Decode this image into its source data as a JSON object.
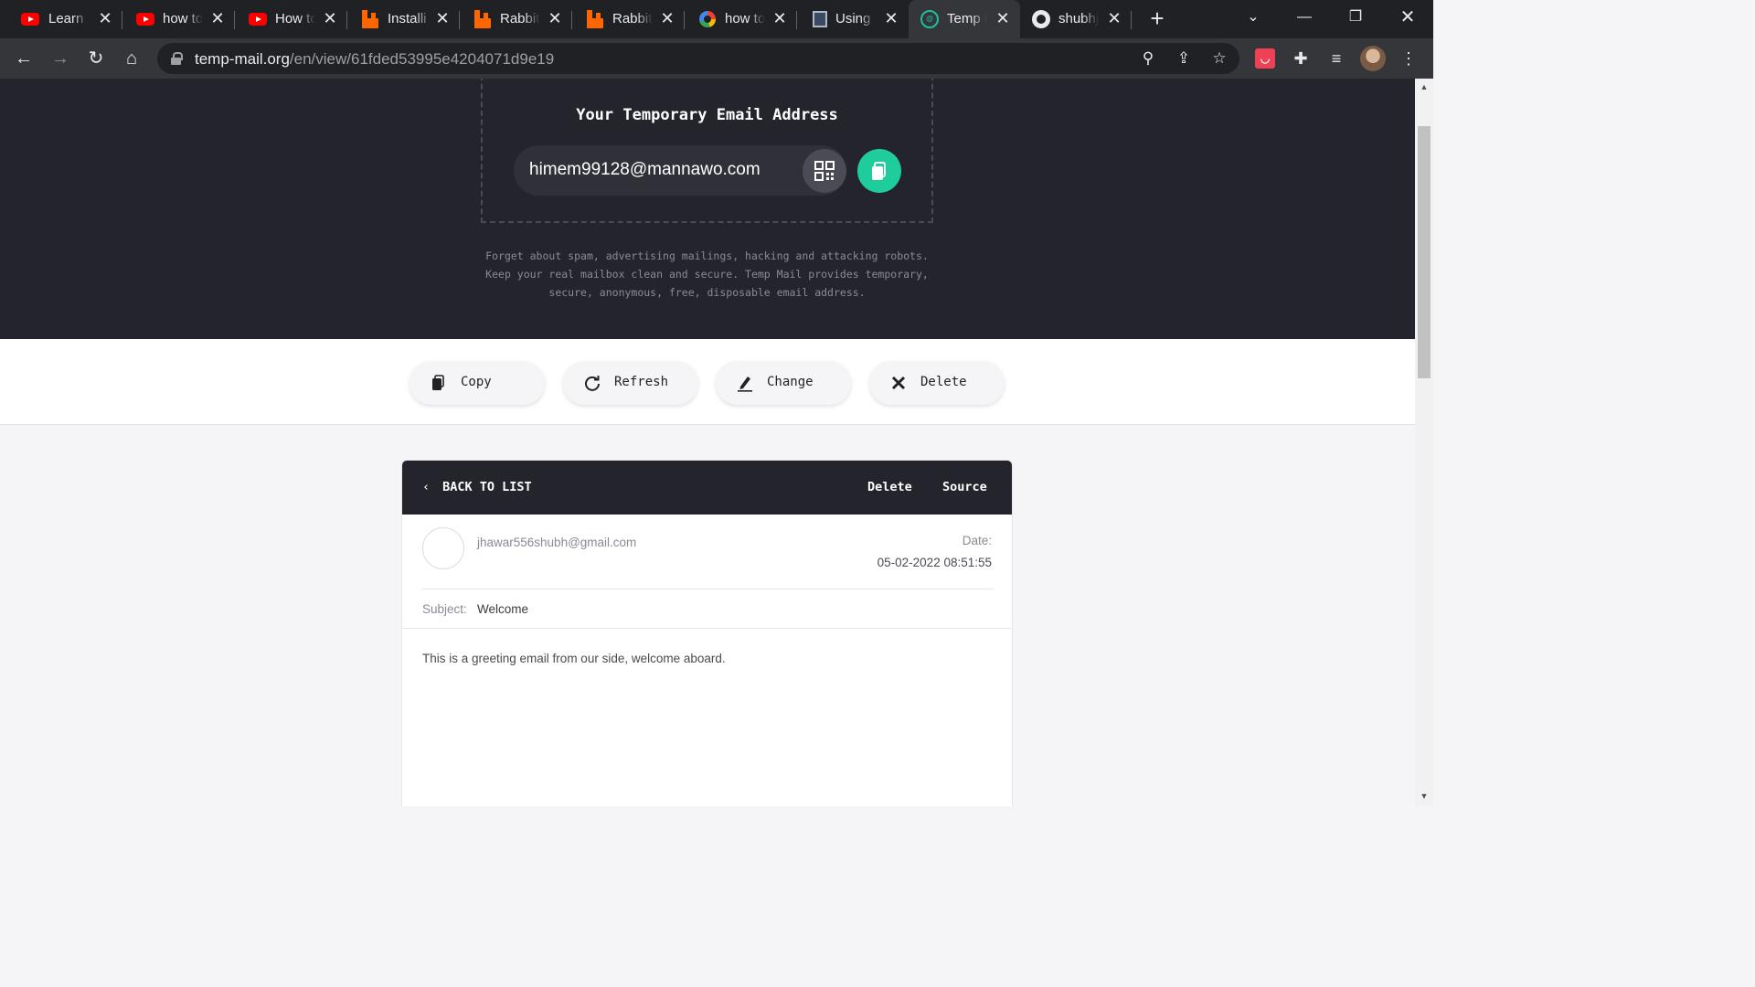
{
  "browser": {
    "tabs": [
      {
        "title": "Learn I",
        "icon": "youtube-icon",
        "active": false
      },
      {
        "title": "how to",
        "icon": "youtube-icon",
        "active": false
      },
      {
        "title": "How to",
        "icon": "youtube-icon",
        "active": false
      },
      {
        "title": "Installi",
        "icon": "rabbitmq-icon",
        "active": false
      },
      {
        "title": "Rabbit",
        "icon": "rabbitmq-icon",
        "active": false
      },
      {
        "title": "Rabbit",
        "icon": "rabbitmq-icon",
        "active": false
      },
      {
        "title": "how to",
        "icon": "google-icon",
        "active": false
      },
      {
        "title": "Using I",
        "icon": "document-icon",
        "active": false
      },
      {
        "title": "Temp I",
        "icon": "tempmail-icon",
        "active": true
      },
      {
        "title": "shubhj",
        "icon": "github-icon",
        "active": false
      }
    ],
    "url_host": "temp-mail.org",
    "url_path": "/en/view/61fded53995e4204071d9e19"
  },
  "hero": {
    "title": "Your Temporary Email Address",
    "email": "himem99128@mannawo.com",
    "description_lines": [
      "Forget about spam, advertising mailings, hacking and attacking robots.",
      "Keep your real mailbox clean and secure. Temp Mail provides temporary,",
      "secure, anonymous, free, disposable email address."
    ]
  },
  "actions": {
    "copy": "Copy",
    "refresh": "Refresh",
    "change": "Change",
    "delete": "Delete"
  },
  "mail": {
    "back_label": "BACK TO LIST",
    "delete_label": "Delete",
    "source_label": "Source",
    "sender": "jhawar556shubh@gmail.com",
    "date_label": "Date:",
    "date_value": "05-02-2022 08:51:55",
    "subject_label": "Subject:",
    "subject_value": "Welcome",
    "body": "This is a greeting email from our side, welcome aboard."
  },
  "colors": {
    "hero_bg": "#24242d",
    "accent": "#1fcc9c",
    "chrome_dark": "#202124",
    "chrome_toolbar": "#35363a"
  }
}
